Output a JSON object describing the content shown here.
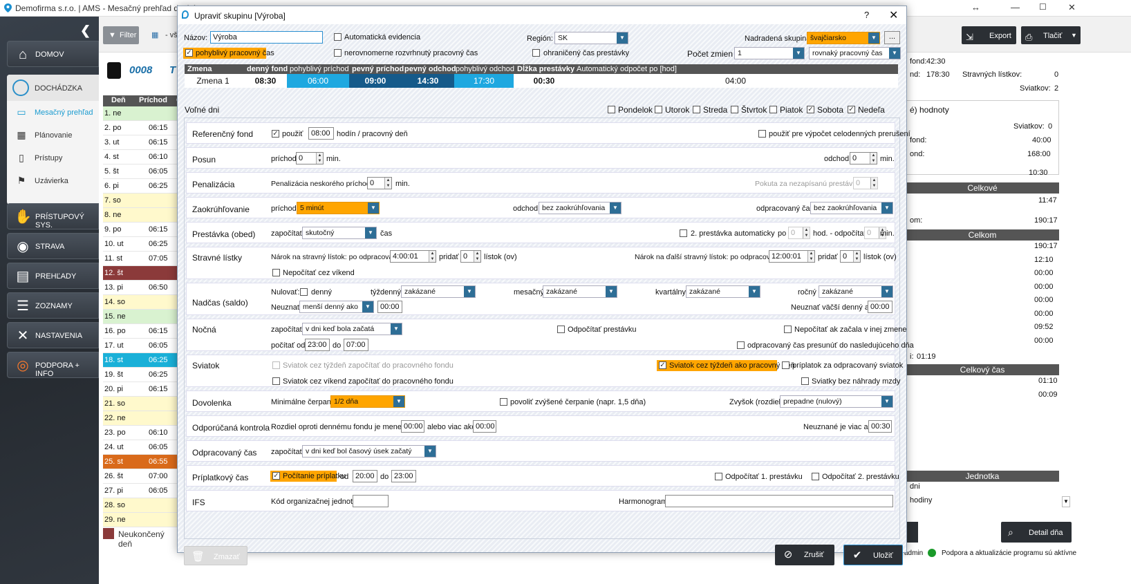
{
  "window": {
    "title": "Demofirma s.r.o. | AMS - Mesačný prehľad docház",
    "resize_icon": "↔"
  },
  "sidebar": {
    "items": [
      {
        "label": "DOMOV",
        "icon": "home-icon"
      },
      {
        "label": "DOCHÁDZKA",
        "icon": "clock-icon"
      },
      {
        "label": "PRÍSTUPOVÝ SYS.",
        "icon": "handshake-icon"
      },
      {
        "label": "STRAVA",
        "icon": "plate-icon"
      },
      {
        "label": "PREHĽADY",
        "icon": "book-icon"
      },
      {
        "label": "ZOZNAMY",
        "icon": "list-icon"
      },
      {
        "label": "NASTAVENIA",
        "icon": "tools-icon"
      },
      {
        "label": "PODPORA + INFO",
        "icon": "lifebuoy-icon"
      }
    ],
    "sub_items": [
      {
        "label": "Mesačný prehľad",
        "active": true
      },
      {
        "label": "Plánovanie"
      },
      {
        "label": "Prístupy"
      },
      {
        "label": "Uzávierka"
      }
    ]
  },
  "toolbar": {
    "filter_label": "Filter",
    "select_value": "- vš",
    "export_label": "Export",
    "print_label": "Tlačiť"
  },
  "employee": {
    "number": "0008",
    "name_fragment": "T"
  },
  "day_table": {
    "headers": [
      "Deň",
      "Príchod",
      "O"
    ],
    "rows": [
      {
        "day": "1. ne",
        "arrival": "",
        "color": "#d9f2d0"
      },
      {
        "day": "2. po",
        "arrival": "06:15",
        "color": "#ffffff"
      },
      {
        "day": "3. ut",
        "arrival": "06:15",
        "color": "#ffffff"
      },
      {
        "day": "4. st",
        "arrival": "06:10",
        "color": "#ffffff"
      },
      {
        "day": "5. št",
        "arrival": "06:05",
        "color": "#ffffff"
      },
      {
        "day": "6. pi",
        "arrival": "06:25",
        "color": "#ffffff"
      },
      {
        "day": "7. so",
        "arrival": "",
        "color": "#fff9cc"
      },
      {
        "day": "8. ne",
        "arrival": "",
        "color": "#fff9cc"
      },
      {
        "day": "9. po",
        "arrival": "06:15",
        "color": "#ffffff"
      },
      {
        "day": "10. ut",
        "arrival": "06:25",
        "color": "#ffffff"
      },
      {
        "day": "11. st",
        "arrival": "07:05",
        "color": "#ffffff"
      },
      {
        "day": "12. št",
        "arrival": "",
        "color": "#8b3a3a",
        "text": "#ffffff"
      },
      {
        "day": "13. pi",
        "arrival": "06:50",
        "color": "#ffffff"
      },
      {
        "day": "14. so",
        "arrival": "",
        "color": "#fff9cc"
      },
      {
        "day": "15. ne",
        "arrival": "",
        "color": "#d9f2d0"
      },
      {
        "day": "16. po",
        "arrival": "06:15",
        "color": "#ffffff"
      },
      {
        "day": "17. ut",
        "arrival": "06:05",
        "color": "#ffffff"
      },
      {
        "day": "18. st",
        "arrival": "06:25",
        "color": "#1ab0d8",
        "text": "#ffffff"
      },
      {
        "day": "19. št",
        "arrival": "06:25",
        "color": "#ffffff"
      },
      {
        "day": "20. pi",
        "arrival": "06:15",
        "color": "#ffffff"
      },
      {
        "day": "21. so",
        "arrival": "",
        "color": "#fff9cc"
      },
      {
        "day": "22. ne",
        "arrival": "",
        "color": "#fff9cc"
      },
      {
        "day": "23. po",
        "arrival": "06:10",
        "color": "#ffffff"
      },
      {
        "day": "24. ut",
        "arrival": "06:05",
        "color": "#ffffff"
      },
      {
        "day": "25. st",
        "arrival": "06:55",
        "color": "#d96a1a",
        "text": "#ffffff"
      },
      {
        "day": "26. št",
        "arrival": "07:00",
        "color": "#ffffff"
      },
      {
        "day": "27. pi",
        "arrival": "06:05",
        "color": "#ffffff"
      },
      {
        "day": "28. so",
        "arrival": "",
        "color": "#fff9cc"
      },
      {
        "day": "29. ne",
        "arrival": "",
        "color": "#fff9cc"
      }
    ],
    "legend": "Neukončený deň"
  },
  "right_panel": {
    "lines": [
      {
        "label": "fond:",
        "value": "42:30"
      },
      {
        "label": "nd:",
        "value": "178:30"
      },
      {
        "label": "Stravných lístkov:",
        "value": "0"
      },
      {
        "label": "Sviatkov:",
        "value": "2"
      },
      {
        "label": "é) hodnoty",
        "value": ""
      },
      {
        "label": "Sviatkov:",
        "value": "0"
      },
      {
        "label": "fond:",
        "value": "40:00"
      },
      {
        "label": "ond:",
        "value": "168:00"
      },
      {
        "label": "",
        "value": "10:30"
      },
      {
        "label": "",
        "value": "11:47"
      },
      {
        "label": "om:",
        "value": "190:17"
      },
      {
        "label": "i:",
        "value": "01:19"
      }
    ],
    "bars": [
      "Celkové",
      "Celkom",
      "Celkový čas",
      "Jednotka"
    ],
    "celkom_values": [
      "190:17",
      "12:10",
      "00:00",
      "00:00",
      "00:00",
      "00:00",
      "09:52",
      "00:00"
    ],
    "celkovy_cas_values": [
      "01:10",
      "00:09"
    ],
    "jednotka_values": [
      "dni",
      "hodiny"
    ],
    "detail_label": "Detail dňa",
    "status_user": "admin",
    "status_text": "Podpora a aktualizácie programu sú aktívne"
  },
  "dialog": {
    "title": "Upraviť skupinu [Výroba]",
    "help": "?",
    "close": "✕",
    "nazov_label": "Názov:",
    "nazov_value": "Výroba",
    "auto_evidencia": "Automatická evidencia",
    "region_label": "Región:",
    "region_value": "SK",
    "parent_label": "Nadradená skupina:",
    "parent_value": "švajčiarsko",
    "more": "...",
    "flexi": "pohyblivý pracovný čas",
    "uneven": "nerovnomerne rozvrhnutý pracovný čas",
    "limited_break": "ohraničený čas prestávky",
    "shifts_label": "Počet zmien",
    "shifts_value": "1",
    "shifts_type": "rovnaký pracovný čas",
    "shift_headers": [
      "Zmena",
      "denný fond",
      "pohyblivý príchod",
      "pevný príchod",
      "pevný odchod",
      "pohyblivý odchod",
      "Dĺžka prestávky",
      "Automatický odpočet po [hod]"
    ],
    "shift_row": [
      "Zmena 1",
      "08:30",
      "06:00",
      "09:00",
      "14:30",
      "17:30",
      "00:30",
      "04:00"
    ],
    "free_days_label": "Voľné dni",
    "weekdays": [
      {
        "label": "Pondelok",
        "on": false
      },
      {
        "label": "Utorok",
        "on": false
      },
      {
        "label": "Streda",
        "on": false
      },
      {
        "label": "Štvrtok",
        "on": false
      },
      {
        "label": "Piatok",
        "on": false
      },
      {
        "label": "Sobota",
        "on": true
      },
      {
        "label": "Nedeľa",
        "on": true
      }
    ],
    "sections": {
      "ref": {
        "title": "Referenčný fond",
        "use": "použiť",
        "hours": "08:00",
        "per_day": "hodín / pracovný deň",
        "use_for": "použiť pre výpočet celodenných prerušení"
      },
      "shift": {
        "title": "Posun",
        "arr": "príchod",
        "arr_val": "0",
        "min": "min.",
        "dep": "odchod",
        "dep_val": "0"
      },
      "pen": {
        "title": "Penalizácia",
        "late": "Penalizácia neskorého príchodu:",
        "late_val": "0",
        "fine": "Pokuta za nezapísanú prestávku",
        "fine_val": "0"
      },
      "round": {
        "title": "Zaokrúhľovanie",
        "arr": "príchod",
        "arr_val": "5 minút",
        "dep": "odchod",
        "dep_val": "bez zaokrúhľovania",
        "worked": "odpracovaný čas",
        "worked_val": "bez zaokrúhľovania"
      },
      "brk": {
        "title": "Prestávka (obed)",
        "count": "započítať",
        "count_val": "skutočný",
        "cas": "čas",
        "second": "2. prestávka automaticky",
        "po": "po",
        "po_val": "0",
        "hod": "hod. - odpočítať",
        "hod_val": "0",
        "min": "min."
      },
      "meal": {
        "title": "Stravné lístky",
        "claim": "Nárok na stravný lístok: po odpracovaní",
        "claim_val": "4:00:01",
        "add": "pridať",
        "add_val": "0",
        "tickets": "lístok (ov)",
        "claim2": "Nárok na ďalší stravný lístok: po odpracovaní",
        "claim2_val": "12:00:01",
        "add2_val": "0",
        "weekend": "Nepočítať cez víkend"
      },
      "ot": {
        "title": "Nadčas (saldo)",
        "reset": "Nulovať:",
        "daily": "denný",
        "weekly": "týždenný",
        "weekly_val": "zakázané",
        "monthly": "mesačný",
        "monthly_val": "zakázané",
        "quarterly": "kvartálny",
        "quarterly_val": "zakázané",
        "yearly": "ročný",
        "yearly_val": "zakázané",
        "ignore": "Neuznať",
        "ignore_val": "menší denný ako",
        "ignore_time": "00:00",
        "ignore2": "Neuznať väčší denný ako",
        "ignore2_time": "00:00"
      },
      "night": {
        "title": "Nočná",
        "count": "započítať",
        "count_val": "v dni keď bola začatá",
        "deduct": "Odpočítať prestávku",
        "not_other": "Nepočítať ak začala v inej zmene",
        "from": "počítať od",
        "from_val": "23:00",
        "to": "do",
        "to_val": "07:00",
        "move": "odpracovaný čas presunúť do nasledujúceho dňa"
      },
      "hol": {
        "title": "Sviatok",
        "wk_fund": "Sviatok cez týždeň započítať do pracovného fondu",
        "wk_day": "Sviatok cez týždeň ako pracovný deň",
        "bonus": "príplatok za odpracovaný sviatok",
        "we_fund": "Sviatok cez víkend započítať do pracovného fondu",
        "no_comp": "Sviatky bez náhrady mzdy"
      },
      "vac": {
        "title": "Dovolenka",
        "min": "Minimálne čerpanie",
        "min_val": "1/2 dňa",
        "allow": "povoliť zvýšené čerpanie (napr. 1,5 dňa)",
        "rest": "Zvyšok (rozdiel)",
        "rest_val": "prepadne (nulový)"
      },
      "rec": {
        "title": "Odporúčaná kontrola",
        "diff": "Rozdiel oproti dennému fondu je menej ako",
        "diff_val": "00:00",
        "or_more": "alebo viac ako",
        "more_val": "00:00",
        "unrec": "Neuznané je viac ako",
        "unrec_val": "00:30"
      },
      "worked": {
        "title": "Odpracovaný čas",
        "count": "započítať",
        "count_val": "v dni keď bol časový úsek  začatý"
      },
      "sur": {
        "title": "Príplatkový čas",
        "calc": "Počítanie príplatku",
        "from": "od",
        "from_val": "20:00",
        "to": "do",
        "to_val": "23:00",
        "d1": "Odpočítať 1. prestávku",
        "d2": "Odpočítať 2. prestávku"
      },
      "ifs": {
        "title": "IFS",
        "code": "Kód organizačnej jednotky",
        "harm": "Harmonogram:"
      }
    },
    "delete_label": "Zmazať",
    "cancel_label": "Zrušiť",
    "ok_label": "Uložiť"
  }
}
